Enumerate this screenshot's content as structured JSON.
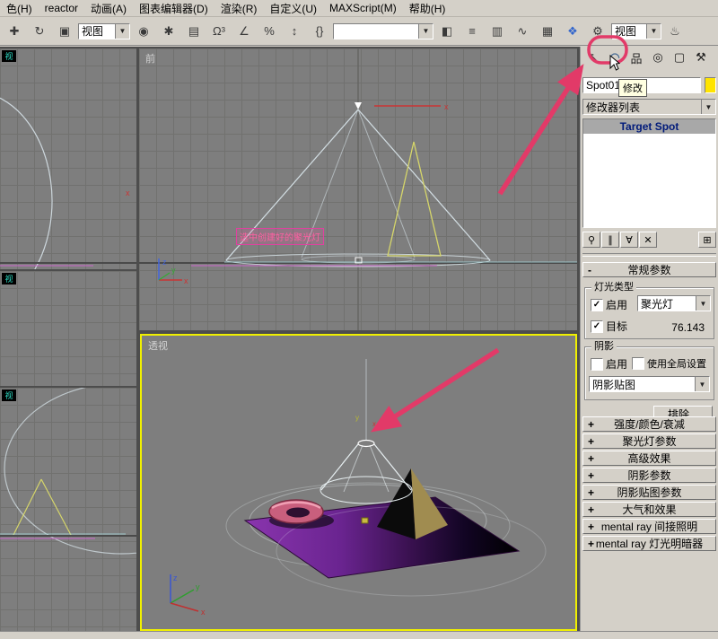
{
  "menu": {
    "items": [
      "色(H)",
      "reactor",
      "动画(A)",
      "图表编辑器(D)",
      "渲染(R)",
      "自定义(U)",
      "MAXScript(M)",
      "帮助(H)"
    ]
  },
  "toolbar": {
    "coord_system": "视图",
    "view_shade": "视图",
    "named_selection_value": "",
    "icons": [
      {
        "name": "select-and-move",
        "glyph": "✚"
      },
      {
        "name": "select-and-rotate",
        "glyph": "↻"
      },
      {
        "name": "select-and-scale",
        "glyph": "▣"
      },
      {
        "name": "use-center",
        "glyph": "◉"
      },
      {
        "name": "select-and-manipulate",
        "glyph": "✱"
      },
      {
        "name": "keyboard-override",
        "glyph": "▤"
      },
      {
        "name": "snap-toggle",
        "glyph": "Ω³"
      },
      {
        "name": "angle-snap",
        "glyph": "∠"
      },
      {
        "name": "percent-snap",
        "glyph": "%"
      },
      {
        "name": "spinner-snap",
        "glyph": "↕"
      },
      {
        "name": "named-selection-sets",
        "glyph": "{}"
      },
      {
        "name": "mirror",
        "glyph": "◧"
      },
      {
        "name": "align",
        "glyph": "≡"
      },
      {
        "name": "layer-manager",
        "glyph": "▥"
      },
      {
        "name": "curve-editor",
        "glyph": "∿"
      },
      {
        "name": "schematic-view",
        "glyph": "▦"
      },
      {
        "name": "material-editor",
        "glyph": "❖"
      },
      {
        "name": "render-setup",
        "glyph": "⚙"
      },
      {
        "name": "quick-render",
        "glyph": "♨"
      }
    ]
  },
  "command_panel": {
    "tabs": [
      {
        "name": "create",
        "glyph": "↖"
      },
      {
        "name": "modify",
        "glyph": "◠"
      },
      {
        "name": "hierarchy",
        "glyph": "品"
      },
      {
        "name": "motion",
        "glyph": "◎"
      },
      {
        "name": "display",
        "glyph": "▢"
      },
      {
        "name": "utilities",
        "glyph": "⚒"
      }
    ],
    "object_name": "Spot01",
    "tooltip": "修改",
    "modifier_list": "修改器列表",
    "stack_item": "Target Spot",
    "stack_buttons": [
      {
        "name": "pin-stack",
        "glyph": "⚲"
      },
      {
        "name": "show-end-result",
        "glyph": "∥"
      },
      {
        "name": "make-unique",
        "glyph": "∀"
      },
      {
        "name": "remove-modifier",
        "glyph": "✕"
      },
      {
        "name": "configure-modifier-sets",
        "glyph": "⊞"
      }
    ],
    "general": {
      "collapse": "-",
      "title": "常规参数",
      "light_type": {
        "title": "灯光类型",
        "enable": "启用",
        "type": "聚光灯",
        "target": "目标",
        "distance": "76.143"
      },
      "shadow": {
        "title": "阴影",
        "enable": "启用",
        "use_global": "使用全局设置",
        "map": "阴影贴图"
      },
      "exclude": "排除..."
    },
    "rollouts": [
      {
        "prefix": "+",
        "label": "强度/颜色/衰减"
      },
      {
        "prefix": "+",
        "label": "聚光灯参数"
      },
      {
        "prefix": "+",
        "label": "高级效果"
      },
      {
        "prefix": "+",
        "label": "阴影参数"
      },
      {
        "prefix": "+",
        "label": "阴影贴图参数"
      },
      {
        "prefix": "+",
        "label": "大气和效果"
      },
      {
        "prefix": "+",
        "label": "mental ray 间接照明"
      },
      {
        "prefix": "+",
        "label": "mental ray 灯光明暗器"
      }
    ]
  },
  "viewports": {
    "front": "前",
    "perspective": "透视",
    "annotation": "选中创建好的聚光灯",
    "mini_label": "视"
  },
  "glyphs": {
    "check": "✓",
    "down": "▼"
  },
  "colors": {
    "annotation": "#e23a68",
    "active_border": "#f0f000",
    "light_swatch": "#ffe400"
  }
}
